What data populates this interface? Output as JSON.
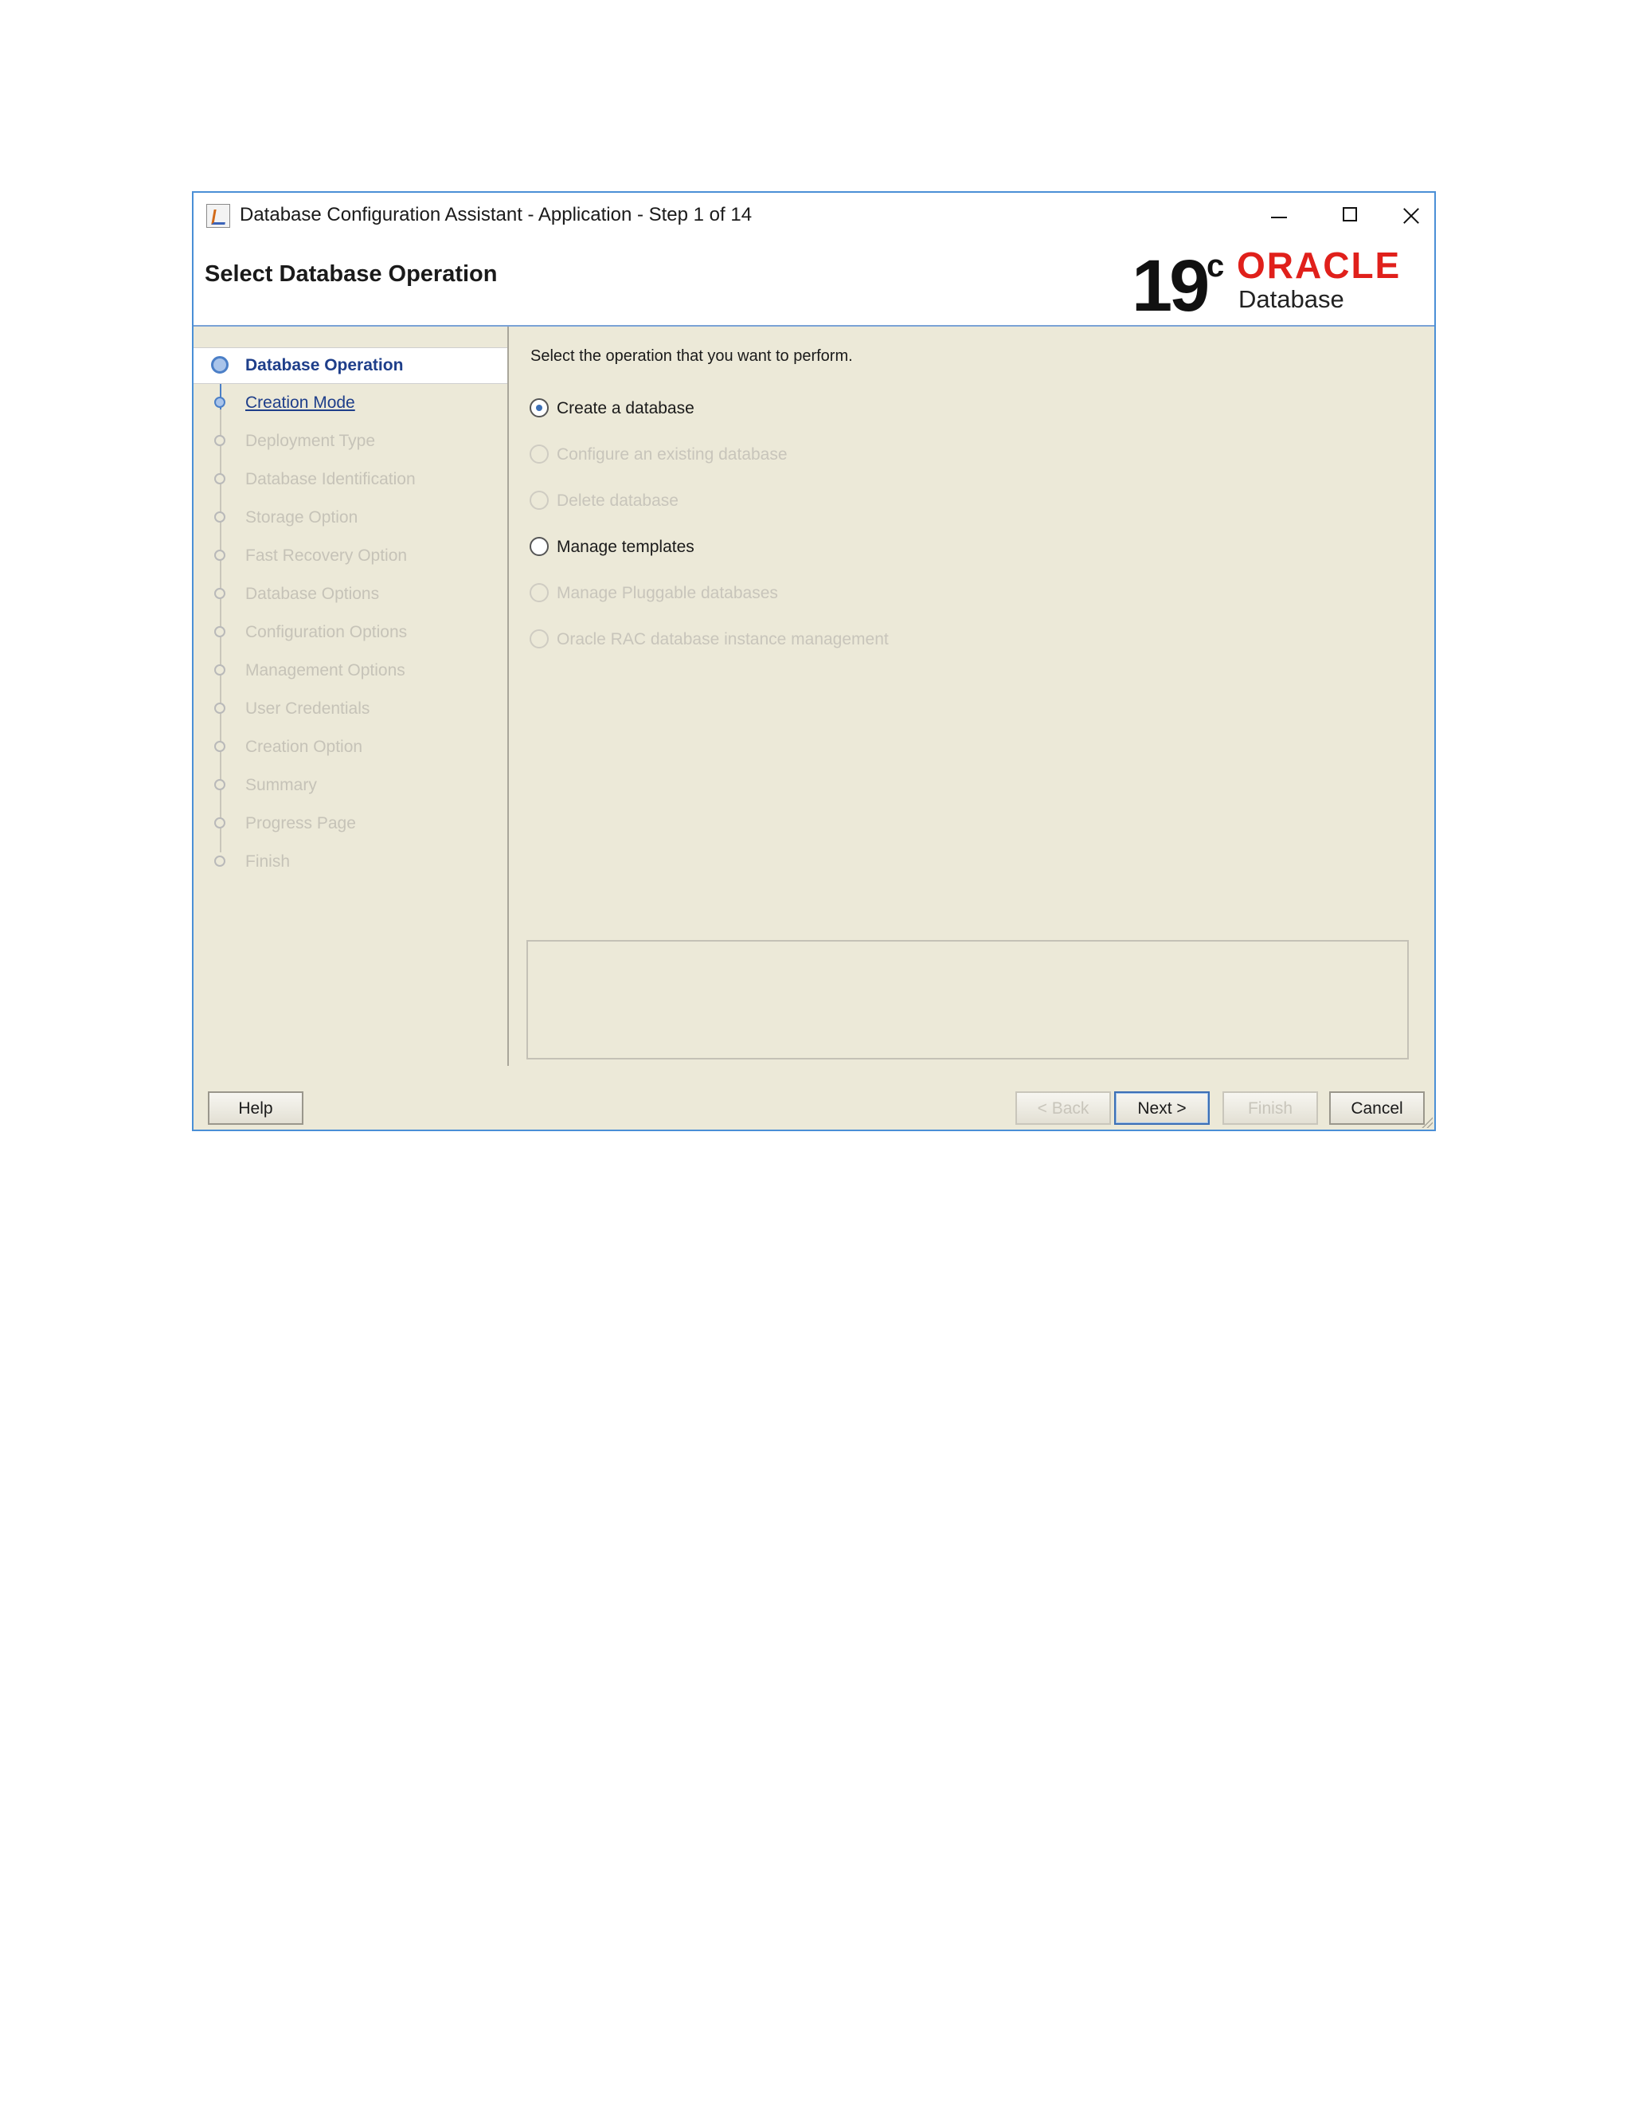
{
  "window": {
    "title": "Database Configuration Assistant - Application - Step 1 of 14",
    "controls": [
      "minimize-icon",
      "maximize-icon",
      "close-icon"
    ]
  },
  "header": {
    "page_title": "Select Database Operation",
    "logo_version": "19",
    "logo_superscript": "c",
    "logo_brand": "ORACLE",
    "logo_product": "Database",
    "brand_color": "#e0201b"
  },
  "steps": [
    {
      "label": "Database Operation",
      "state": "current"
    },
    {
      "label": "Creation Mode",
      "state": "active"
    },
    {
      "label": "Deployment Type",
      "state": "disabled"
    },
    {
      "label": "Database Identification",
      "state": "disabled"
    },
    {
      "label": "Storage Option",
      "state": "disabled"
    },
    {
      "label": "Fast Recovery Option",
      "state": "disabled"
    },
    {
      "label": "Database Options",
      "state": "disabled"
    },
    {
      "label": "Configuration Options",
      "state": "disabled"
    },
    {
      "label": "Management Options",
      "state": "disabled"
    },
    {
      "label": "User Credentials",
      "state": "disabled"
    },
    {
      "label": "Creation Option",
      "state": "disabled"
    },
    {
      "label": "Summary",
      "state": "disabled"
    },
    {
      "label": "Progress Page",
      "state": "disabled"
    },
    {
      "label": "Finish",
      "state": "disabled"
    }
  ],
  "content": {
    "instruction": "Select the operation that you want to perform.",
    "options": [
      {
        "label": "Create a database",
        "checked": true,
        "enabled": true
      },
      {
        "label": "Configure an existing database",
        "checked": false,
        "enabled": false
      },
      {
        "label": "Delete database",
        "checked": false,
        "enabled": false
      },
      {
        "label": "Manage templates",
        "checked": false,
        "enabled": true
      },
      {
        "label": "Manage Pluggable databases",
        "checked": false,
        "enabled": false
      },
      {
        "label": "Oracle RAC database instance management",
        "checked": false,
        "enabled": false
      }
    ]
  },
  "buttons": {
    "help": "Help",
    "back": "< Back",
    "next": "Next >",
    "finish": "Finish",
    "cancel": "Cancel"
  }
}
